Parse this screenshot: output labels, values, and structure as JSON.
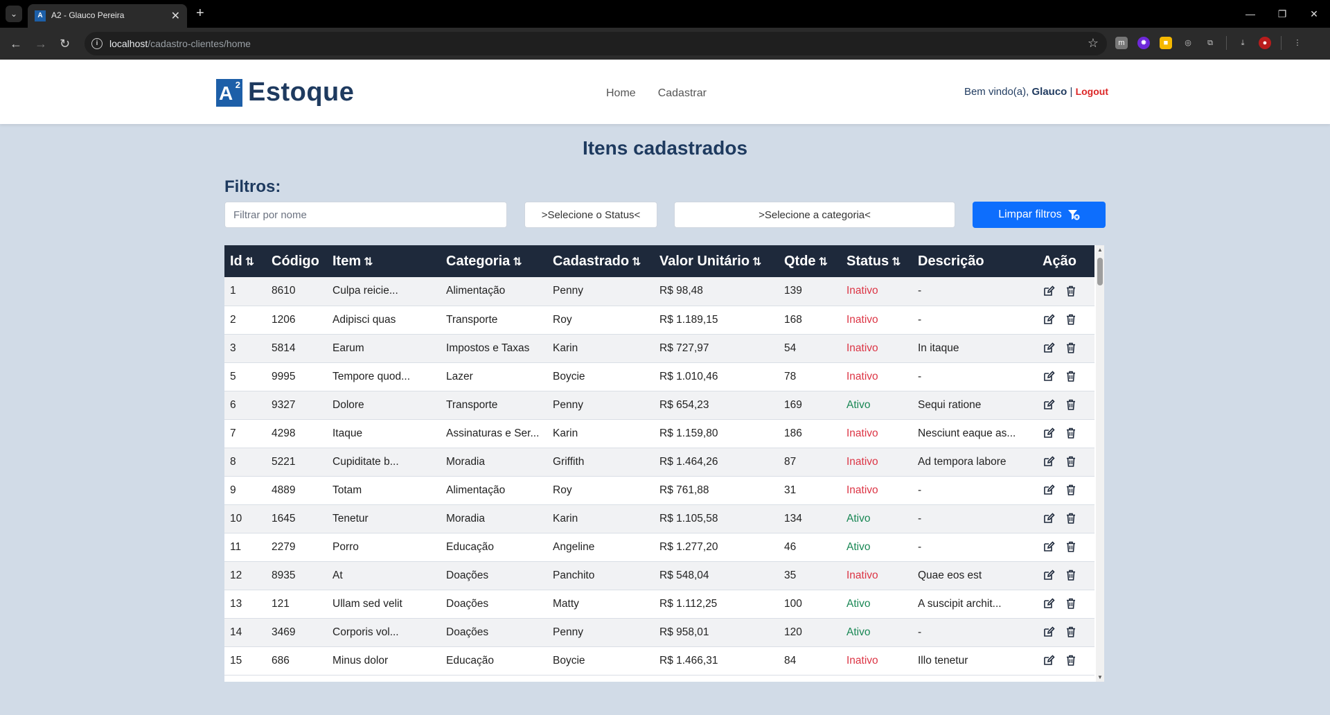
{
  "browser": {
    "tab_title": "A2 - Glauco Pereira",
    "url_host": "localhost",
    "url_path": "/cadastro-clientes/home"
  },
  "header": {
    "logo_sup": "2",
    "logo_letter": "A",
    "logo_text": "Estoque",
    "nav": [
      "Home",
      "Cadastrar"
    ],
    "welcome_prefix": "Bem vindo(a), ",
    "user_name": "Glauco",
    "separator": " | ",
    "logout_label": "Logout"
  },
  "page": {
    "title": "Itens cadastrados",
    "filters_label": "Filtros:",
    "name_placeholder": "Filtrar por nome",
    "status_select": ">Selecione o Status<",
    "category_select": ">Selecione a categoria<",
    "clear_button": "Limpar filtros"
  },
  "table": {
    "headers": [
      "Id",
      "Código",
      "Item",
      "Categoria",
      "Cadastrado",
      "Valor Unitário",
      "Qtde",
      "Status",
      "Descrição",
      "Ação"
    ],
    "rows": [
      [
        "1",
        "8610",
        "Culpa reicie...",
        "Alimentação",
        "Penny",
        "R$ 98,48",
        "139",
        "Inativo",
        "-"
      ],
      [
        "2",
        "1206",
        "Adipisci quas",
        "Transporte",
        "Roy",
        "R$ 1.189,15",
        "168",
        "Inativo",
        "-"
      ],
      [
        "3",
        "5814",
        "Earum",
        "Impostos e Taxas",
        "Karin",
        "R$ 727,97",
        "54",
        "Inativo",
        "In itaque"
      ],
      [
        "5",
        "9995",
        "Tempore quod...",
        "Lazer",
        "Boycie",
        "R$ 1.010,46",
        "78",
        "Inativo",
        "-"
      ],
      [
        "6",
        "9327",
        "Dolore",
        "Transporte",
        "Penny",
        "R$ 654,23",
        "169",
        "Ativo",
        "Sequi ratione"
      ],
      [
        "7",
        "4298",
        "Itaque",
        "Assinaturas e Ser...",
        "Karin",
        "R$ 1.159,80",
        "186",
        "Inativo",
        "Nesciunt eaque as..."
      ],
      [
        "8",
        "5221",
        "Cupiditate b...",
        "Moradia",
        "Griffith",
        "R$ 1.464,26",
        "87",
        "Inativo",
        "Ad tempora labore"
      ],
      [
        "9",
        "4889",
        "Totam",
        "Alimentação",
        "Roy",
        "R$ 761,88",
        "31",
        "Inativo",
        "-"
      ],
      [
        "10",
        "1645",
        "Tenetur",
        "Moradia",
        "Karin",
        "R$ 1.105,58",
        "134",
        "Ativo",
        "-"
      ],
      [
        "11",
        "2279",
        "Porro",
        "Educação",
        "Angeline",
        "R$ 1.277,20",
        "46",
        "Ativo",
        "-"
      ],
      [
        "12",
        "8935",
        "At",
        "Doações",
        "Panchito",
        "R$ 548,04",
        "35",
        "Inativo",
        "Quae eos est"
      ],
      [
        "13",
        "121",
        "Ullam sed velit",
        "Doações",
        "Matty",
        "R$ 1.112,25",
        "100",
        "Ativo",
        "A suscipit archit..."
      ],
      [
        "14",
        "3469",
        "Corporis vol...",
        "Doações",
        "Penny",
        "R$ 958,01",
        "120",
        "Ativo",
        "-"
      ],
      [
        "15",
        "686",
        "Minus dolor",
        "Educação",
        "Boycie",
        "R$ 1.466,31",
        "84",
        "Inativo",
        "Illo tenetur"
      ]
    ]
  },
  "colors": {
    "inativo": "#dc3545",
    "ativo": "#198754",
    "primary": "#0d6efd",
    "table_header": "#1e293b"
  },
  "icons": {
    "sort": "sort-arrows-icon",
    "edit": "edit-icon",
    "delete": "trash-icon",
    "filter": "filter-off-icon"
  }
}
